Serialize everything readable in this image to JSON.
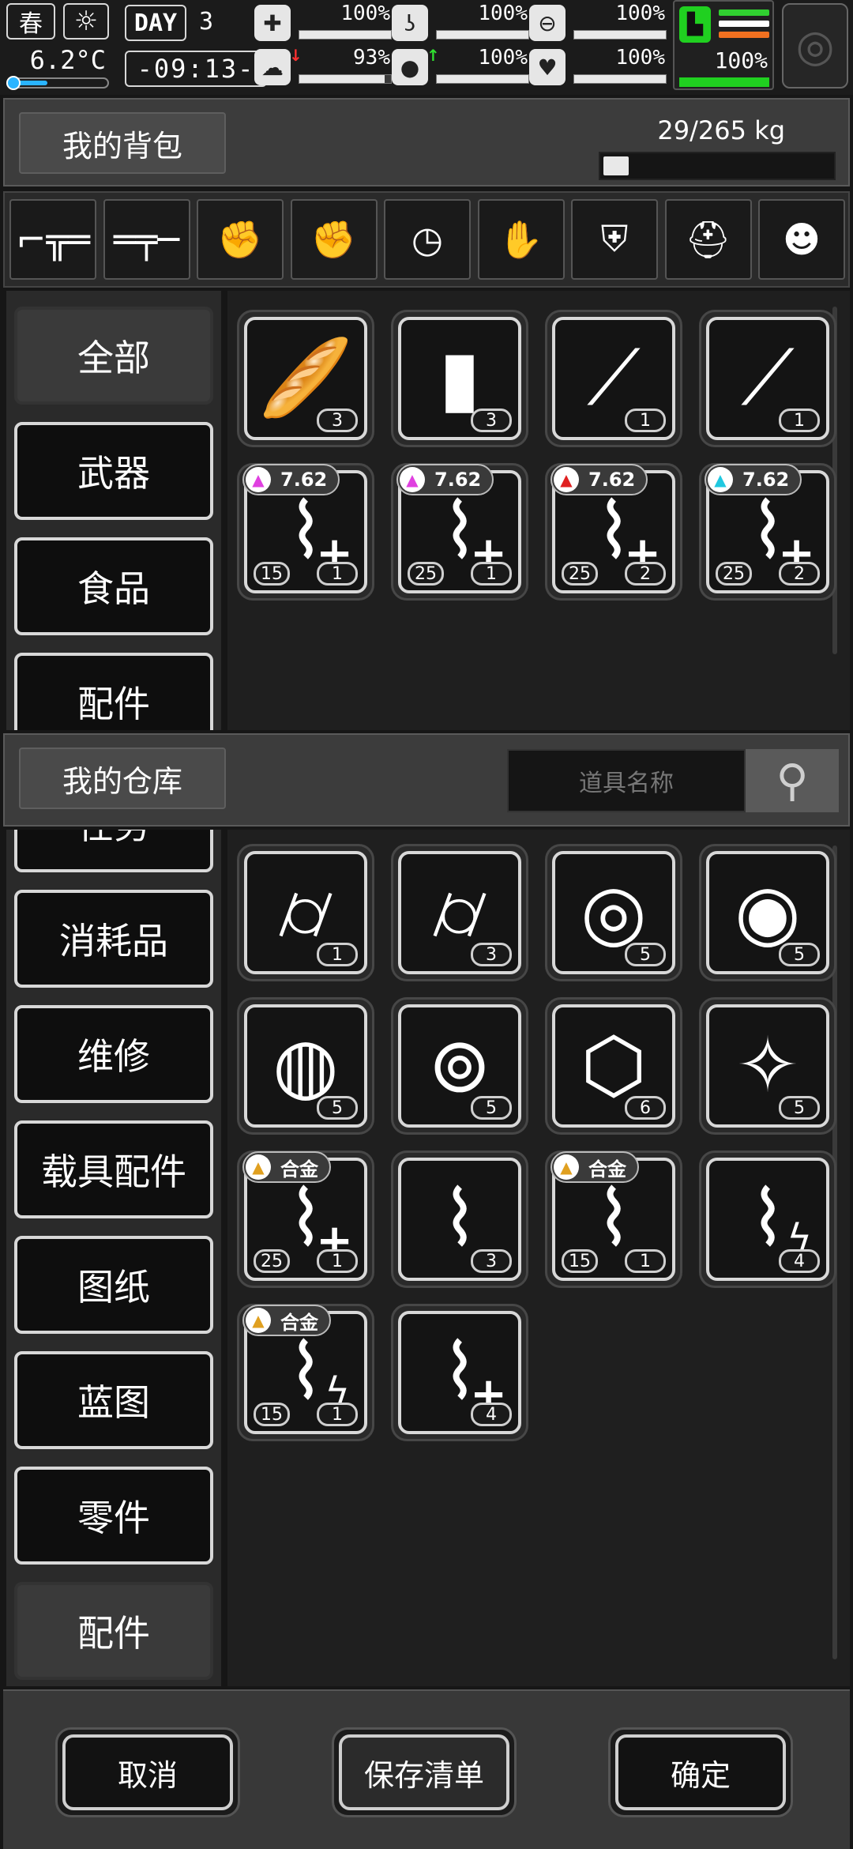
{
  "status": {
    "season": "春",
    "day_label": "DAY",
    "day_number": "3",
    "temperature": "6.2°C",
    "clock": "-09:13-",
    "stats": [
      {
        "icon": "medkit-icon",
        "value": "100%",
        "level": 1.0
      },
      {
        "icon": "stomach-icon",
        "value": "100%",
        "level": 1.0
      },
      {
        "icon": "bladder-icon",
        "value": "100%",
        "level": 1.0
      },
      {
        "icon": "brain-icon",
        "value": "93%",
        "level": 0.93
      },
      {
        "icon": "water-drop-icon",
        "value": "100%",
        "level": 1.0
      },
      {
        "icon": "heart-icon",
        "value": "100%",
        "level": 1.0
      }
    ],
    "stamina": "100%"
  },
  "bag": {
    "title": "我的背包",
    "weight": "29/265 kg",
    "weight_fraction": 0.109
  },
  "equipment": [
    {
      "icon": "sniper-rifle-icon",
      "glyph": "⌐╦═",
      "empty": false
    },
    {
      "icon": "rifle-icon",
      "glyph": "═╤─",
      "empty": false
    },
    {
      "icon": "empty-glove-slot-icon",
      "glyph": "✊",
      "empty": true
    },
    {
      "icon": "empty-glove-slot-icon",
      "glyph": "✊",
      "empty": true
    },
    {
      "icon": "wristwatch-icon",
      "glyph": "◷",
      "empty": false
    },
    {
      "icon": "gloves-icon",
      "glyph": "✋",
      "empty": false
    },
    {
      "icon": "armor-vest-icon",
      "glyph": "⛨",
      "empty": false
    },
    {
      "icon": "helmet-icon",
      "glyph": "⛑",
      "empty": false
    },
    {
      "icon": "backpack-pet-icon",
      "glyph": "☻",
      "empty": false
    }
  ],
  "bag_categories": [
    "全部",
    "武器",
    "食品",
    "配件"
  ],
  "bag_items": [
    {
      "icon": "bread-icon",
      "glyph": "🥖",
      "qty": "3"
    },
    {
      "icon": "water-bottle-icon",
      "glyph": "▮",
      "qty": "3"
    },
    {
      "icon": "machete-icon",
      "glyph": "⟋",
      "qty": "1"
    },
    {
      "icon": "saw-blade-icon",
      "glyph": "⟋",
      "qty": "1"
    },
    {
      "icon": "magazine-icon",
      "glyph": "⌇",
      "qty": "1",
      "cap": "15",
      "tag": "7.62",
      "tag_icon": "poison-bullet-icon",
      "tag_color": "#e040e0",
      "plus": true
    },
    {
      "icon": "magazine-icon",
      "glyph": "⌇",
      "qty": "1",
      "cap": "25",
      "tag": "7.62",
      "tag_icon": "poison-bullet-icon",
      "tag_color": "#e040e0",
      "plus": true
    },
    {
      "icon": "magazine-icon",
      "glyph": "⌇",
      "qty": "2",
      "cap": "25",
      "tag": "7.62",
      "tag_icon": "fire-bullet-icon",
      "tag_color": "#e02020",
      "plus": true
    },
    {
      "icon": "magazine-icon",
      "glyph": "⌇",
      "qty": "2",
      "cap": "25",
      "tag": "7.62",
      "tag_icon": "frost-bullet-icon",
      "tag_color": "#20c8e0",
      "plus": true
    }
  ],
  "warehouse": {
    "title": "我的仓库",
    "search_placeholder": "道具名称"
  },
  "warehouse_categories": [
    "任务",
    "消耗品",
    "维修",
    "载具配件",
    "图纸",
    "蓝图",
    "零件",
    "配件"
  ],
  "warehouse_items": [
    {
      "icon": "scope-icon",
      "glyph": "⌭",
      "qty": "1"
    },
    {
      "icon": "scope-icon",
      "glyph": "⌭",
      "qty": "3"
    },
    {
      "icon": "shield-module-icon",
      "glyph": "◎",
      "qty": "5"
    },
    {
      "icon": "lightning-module-icon",
      "glyph": "◉",
      "qty": "5"
    },
    {
      "icon": "fire-module-icon",
      "glyph": "◍",
      "qty": "5"
    },
    {
      "icon": "target-module-icon",
      "glyph": "⊚",
      "qty": "5"
    },
    {
      "icon": "hexagon-module-icon",
      "glyph": "⬡",
      "qty": "6"
    },
    {
      "icon": "diamond-module-icon",
      "glyph": "✧",
      "qty": "5"
    },
    {
      "icon": "magazine-icon",
      "glyph": "⌇",
      "qty": "1",
      "cap": "25",
      "tag": "合金",
      "tag_icon": "alloy-bullet-icon",
      "tag_color": "#e0a020",
      "plus": true
    },
    {
      "icon": "magazine-icon",
      "glyph": "⌇",
      "qty": "3"
    },
    {
      "icon": "magazine-icon",
      "glyph": "⌇",
      "qty": "1",
      "cap": "15",
      "tag": "合金",
      "tag_icon": "alloy-bullet-icon",
      "tag_color": "#e0a020"
    },
    {
      "icon": "magazine-icon",
      "glyph": "⌇",
      "qty": "4",
      "bolt": true
    },
    {
      "icon": "magazine-icon",
      "glyph": "⌇",
      "qty": "1",
      "cap": "15",
      "tag": "合金",
      "tag_icon": "alloy-bullet-icon",
      "tag_color": "#e0a020",
      "bolt": true
    },
    {
      "icon": "magazine-icon",
      "glyph": "⌇",
      "qty": "4",
      "plus": true
    }
  ],
  "footer": {
    "cancel": "取消",
    "save_list": "保存清单",
    "confirm": "确定"
  }
}
